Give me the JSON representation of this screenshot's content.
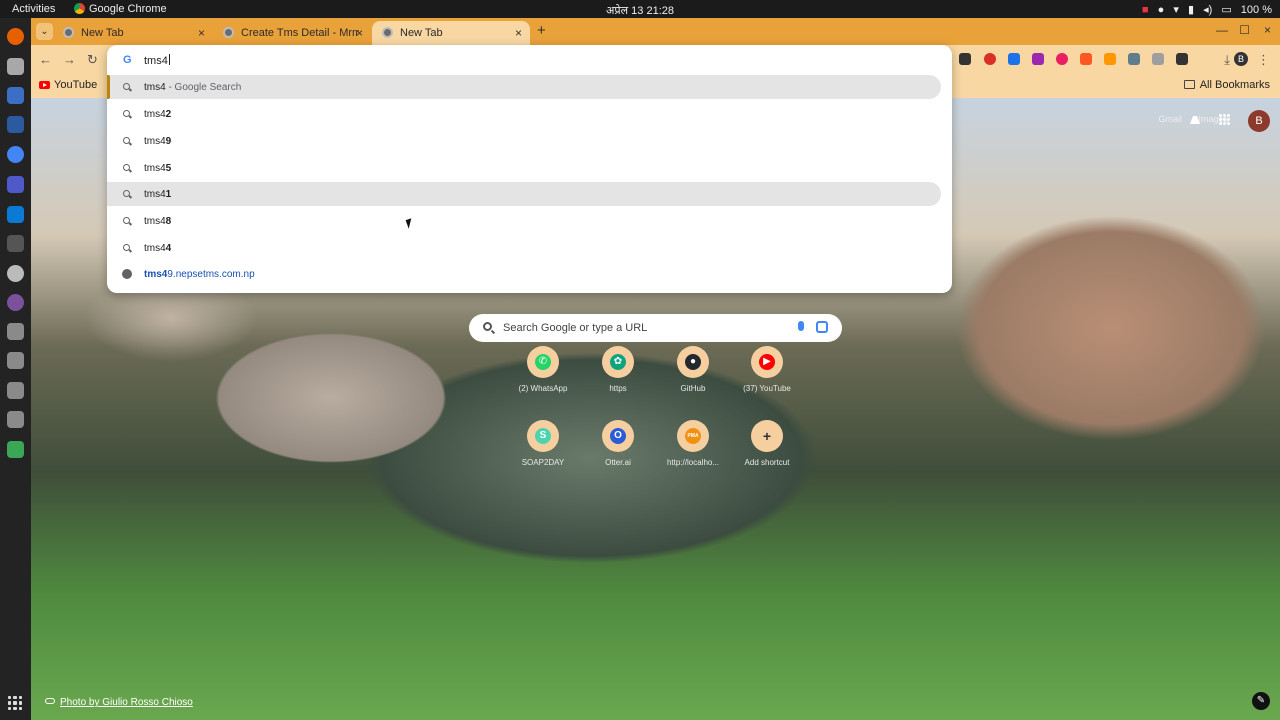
{
  "topbar": {
    "activities": "Activities",
    "app_name": "Google Chrome",
    "clock": "अप्रेल 13  21:28",
    "battery": "100 %"
  },
  "dock": {
    "icons": [
      "firefox-icon",
      "files-icon",
      "writer-icon",
      "terminal-blue-icon",
      "chrome-icon",
      "teams-icon",
      "vscode-icon",
      "terminal-icon",
      "settings-icon",
      "viber-icon",
      "file-icon-1",
      "file-icon-2",
      "file-icon-3",
      "file-icon-4",
      "trash-icon"
    ],
    "colors": [
      "#e66000",
      "#a8a8a8",
      "#3a6fc4",
      "#2b5aa0",
      "#4285f4",
      "#5059c9",
      "#0a7ad4",
      "#555555",
      "#bbbbbb",
      "#7b519d",
      "#8a8a8a",
      "#8a8a8a",
      "#8a8a8a",
      "#8a8a8a",
      "#3aa757"
    ]
  },
  "tabs": [
    {
      "title": "New Tab",
      "active": false
    },
    {
      "title": "Create Tms Detail - Mrm",
      "active": false
    },
    {
      "title": "New Tab",
      "active": true
    }
  ],
  "toolbar": {
    "close_glyph": "×",
    "new_tab_glyph": "+",
    "back_glyph": "←",
    "forward_glyph": "→",
    "reload_glyph": "↻",
    "download_glyph": "⤓",
    "menu_glyph": "⋮",
    "minimize_glyph": "—",
    "maximize_glyph": "☐",
    "profile_initial": "B",
    "extension_colors": [
      "#333333",
      "#d93025",
      "#1a73e8",
      "#9c27b0",
      "#e91e63",
      "#ff5722",
      "#ff9800",
      "#607d8b",
      "#9e9e9e",
      "#333333"
    ]
  },
  "bookmarks": {
    "youtube": "YouTube",
    "all_bookmarks": "All Bookmarks"
  },
  "omnibox": {
    "typed": "tms4",
    "suggestions": [
      {
        "typed": "tms4",
        "rest": "",
        "desc": " - Google Search",
        "kind": "search"
      },
      {
        "typed": "tms4",
        "rest": "2",
        "desc": "",
        "kind": "search"
      },
      {
        "typed": "tms4",
        "rest": "9",
        "desc": "",
        "kind": "search"
      },
      {
        "typed": "tms4",
        "rest": "5",
        "desc": "",
        "kind": "search"
      },
      {
        "typed": "tms4",
        "rest": "1",
        "desc": "",
        "kind": "search"
      },
      {
        "typed": "tms4",
        "rest": "8",
        "desc": "",
        "kind": "search"
      },
      {
        "typed": "tms4",
        "rest": "4",
        "desc": "",
        "kind": "search"
      },
      {
        "typed": "tms4",
        "rest": "9.nepsetms.com.np",
        "desc": "",
        "kind": "url"
      }
    ]
  },
  "ntp": {
    "gmail": "Gmail",
    "images": "Images",
    "avatar_initial": "B",
    "search_placeholder": "Search Google or type a URL",
    "shortcuts": [
      {
        "label": "(2) WhatsApp",
        "icon": "whatsapp-icon",
        "color": "#25d366",
        "glyph": "✆"
      },
      {
        "label": "https",
        "icon": "openai-icon",
        "color": "#10a37f",
        "glyph": "✿"
      },
      {
        "label": "GitHub",
        "icon": "github-icon",
        "color": "#24292e",
        "glyph": "●"
      },
      {
        "label": "(37) YouTube",
        "icon": "youtube-icon",
        "color": "#ff0000",
        "glyph": "▶"
      },
      {
        "label": "SOAP2DAY",
        "icon": "soap2day-icon",
        "color": "#4cd4b0",
        "glyph": "S"
      },
      {
        "label": "Otter.ai",
        "icon": "otter-icon",
        "color": "#2b5bd7",
        "glyph": "O"
      },
      {
        "label": "http://localho...",
        "icon": "phpmyadmin-icon",
        "color": "#f29111",
        "glyph": "PMA"
      },
      {
        "label": "Add shortcut",
        "icon": "plus-icon",
        "color": "#f5cfa0",
        "glyph": "+"
      }
    ],
    "photo_credit": "Photo by Giulio Rosso Chioso",
    "edit_glyph": "✎"
  }
}
